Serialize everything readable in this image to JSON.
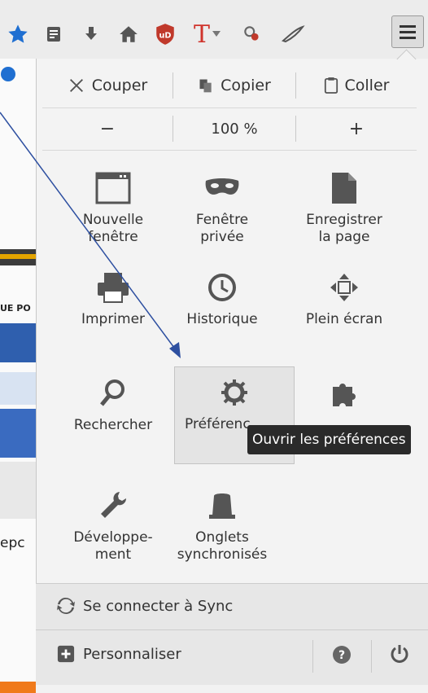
{
  "toolbar": {
    "icons": [
      "bookmark-star-icon",
      "reading-list-icon",
      "download-icon",
      "home-icon",
      "ublock-icon",
      "t-addon-icon",
      "dropdown-caret-icon",
      "extension-icon",
      "feather-icon",
      "hamburger-menu-icon"
    ],
    "t_label": "T"
  },
  "left_partial": {
    "text1": "UE PO",
    "text2": "epc"
  },
  "edit": {
    "cut": "Couper",
    "copy": "Copier",
    "paste": "Coller"
  },
  "zoom": {
    "minus": "−",
    "level": "100 %",
    "plus": "+"
  },
  "tiles": {
    "new_window": {
      "line1": "Nouvelle",
      "line2": "fenêtre"
    },
    "private_window": {
      "line1": "Fenêtre",
      "line2": "privée"
    },
    "save_page": {
      "line1": "Enregistrer",
      "line2": "la page"
    },
    "print": "Imprimer",
    "history": "Historique",
    "fullscreen": "Plein écran",
    "find": "Rechercher",
    "preferences": "Préférences",
    "developer": {
      "line1": "Développe-",
      "line2": "ment"
    },
    "synced_tabs": {
      "line1": "Onglets",
      "line2": "synchronisés"
    }
  },
  "tooltip": "Ouvrir les préférences",
  "sync": {
    "label": "Se connecter à Sync"
  },
  "footer": {
    "customize": "Personnaliser"
  },
  "colors": {
    "accent_blue": "#1f6fd1",
    "ublock_red": "#c0392b",
    "t_red": "#d0342c",
    "arrow": "#2d4fa0"
  }
}
